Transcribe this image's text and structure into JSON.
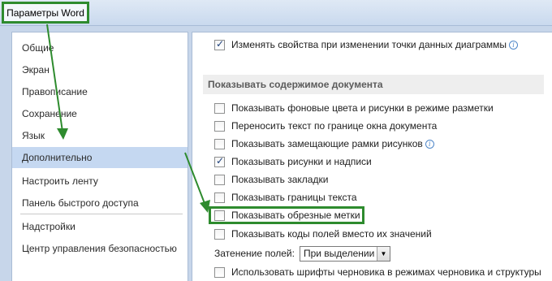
{
  "window": {
    "title": "Параметры Word"
  },
  "sidebar": {
    "items": [
      {
        "label": "Общие"
      },
      {
        "label": "Экран"
      },
      {
        "label": "Правописание"
      },
      {
        "label": "Сохранение"
      },
      {
        "label": "Язык"
      },
      {
        "label": "Дополнительно",
        "selected": true
      },
      {
        "label": "Настроить ленту"
      },
      {
        "label": "Панель быстрого доступа"
      },
      {
        "label": "Надстройки"
      },
      {
        "label": "Центр управления безопасностью"
      }
    ]
  },
  "main": {
    "top_option": {
      "label": "Изменять свойства при изменении точки данных диаграммы",
      "checked": true,
      "info_icon": "info-icon"
    },
    "section_title": "Показывать содержимое документа",
    "options": [
      {
        "label": "Показывать фоновые цвета и рисунки в режиме разметки",
        "checked": false
      },
      {
        "label": "Переносить текст по границе окна документа",
        "checked": false
      },
      {
        "label": "Показывать замещающие рамки рисунков",
        "checked": false,
        "info_icon": "info-icon"
      },
      {
        "label": "Показывать рисунки и надписи",
        "checked": true
      },
      {
        "label": "Показывать закладки",
        "checked": false
      },
      {
        "label": "Показывать границы текста",
        "checked": false
      },
      {
        "label": "Показывать обрезные метки",
        "checked": false,
        "highlighted": true
      },
      {
        "label": "Показывать коды полей вместо их значений",
        "checked": false
      }
    ],
    "field_shading": {
      "label": "Затенение полей:",
      "value": "При выделении"
    },
    "last_option": {
      "label": "Использовать шрифты черновика в режимах черновика и структуры",
      "checked": false
    }
  },
  "colors": {
    "annotation_green": "#2e8b2e",
    "selected_bg": "#c5d8f1",
    "frame_bg": "#c7d6ea"
  }
}
